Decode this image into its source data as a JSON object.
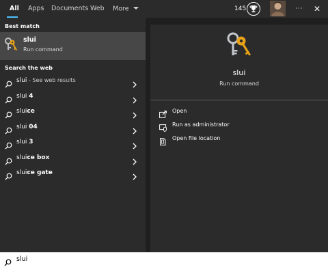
{
  "tabs": [
    "All",
    "Apps",
    "Documents",
    "Web",
    "More"
  ],
  "header": {
    "points": "145",
    "more_options_label": "···",
    "close_label": "✕"
  },
  "best_match": {
    "section_title": "Best match",
    "title": "slui",
    "subtitle": "Run command"
  },
  "web": {
    "section_title": "Search the web",
    "items": [
      {
        "prefix": "slui",
        "bold": "",
        "suffix": " - See web results"
      },
      {
        "prefix": "slui ",
        "bold": "4",
        "suffix": ""
      },
      {
        "prefix": "slui",
        "bold": "ce",
        "suffix": ""
      },
      {
        "prefix": "slui ",
        "bold": "04",
        "suffix": ""
      },
      {
        "prefix": "slui ",
        "bold": "3",
        "suffix": ""
      },
      {
        "prefix": "slui",
        "bold": "ce box",
        "suffix": ""
      },
      {
        "prefix": "slui",
        "bold": "ce gate",
        "suffix": ""
      }
    ]
  },
  "preview": {
    "title": "slui",
    "subtitle": "Run command",
    "actions": [
      {
        "label": "Open",
        "icon": "open-icon"
      },
      {
        "label": "Run as administrator",
        "icon": "shield-admin-icon"
      },
      {
        "label": "Open file location",
        "icon": "file-location-icon"
      }
    ]
  },
  "search": {
    "value": "slui"
  },
  "colors": {
    "accent": "#4cc2ff",
    "panel": "#2b2b2b",
    "selected": "#474747",
    "key": "#e8a317"
  }
}
